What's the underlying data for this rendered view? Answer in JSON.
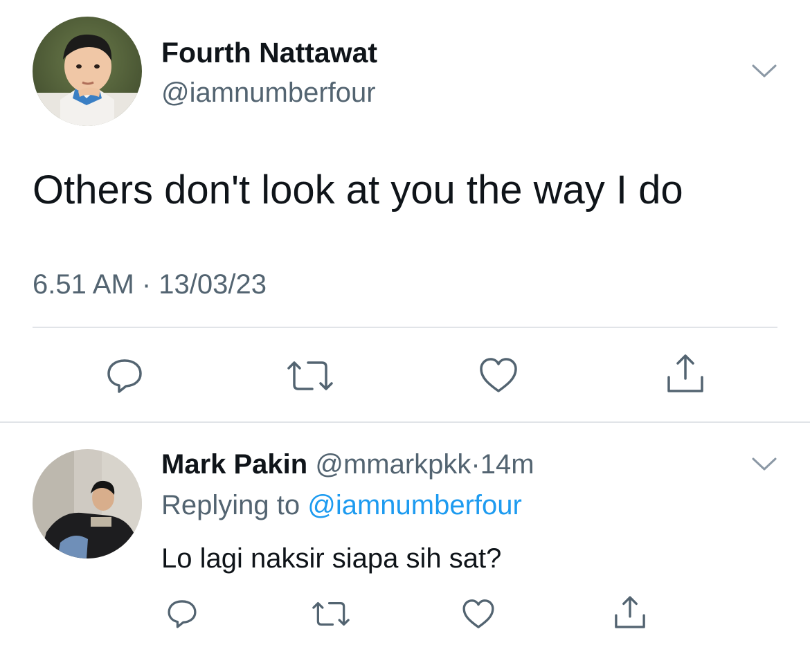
{
  "main_tweet": {
    "author_name": "Fourth Nattawat",
    "author_handle": "@iamnumberfour",
    "text": "Others don't look at you the way I do",
    "timestamp": "6.51 AM · 13/03/23",
    "avatar_icon": "profile-photo",
    "actions": [
      "reply-icon",
      "retweet-icon",
      "like-icon",
      "share-icon"
    ]
  },
  "reply_tweet": {
    "author_name": "Mark Pakin",
    "author_handle": "@mmarkpkk",
    "separator": "·",
    "time_ago": "14m",
    "replying_prefix": "Replying to",
    "replying_to": "@iamnumberfour",
    "text": "Lo lagi naksir siapa sih sat?",
    "avatar_icon": "profile-photo",
    "actions": [
      "reply-icon",
      "retweet-icon",
      "like-icon",
      "share-icon"
    ]
  },
  "colors": {
    "text": "#0f1419",
    "muted": "#536471",
    "link": "#1d9bf0",
    "divider": "#e1e4e8"
  }
}
